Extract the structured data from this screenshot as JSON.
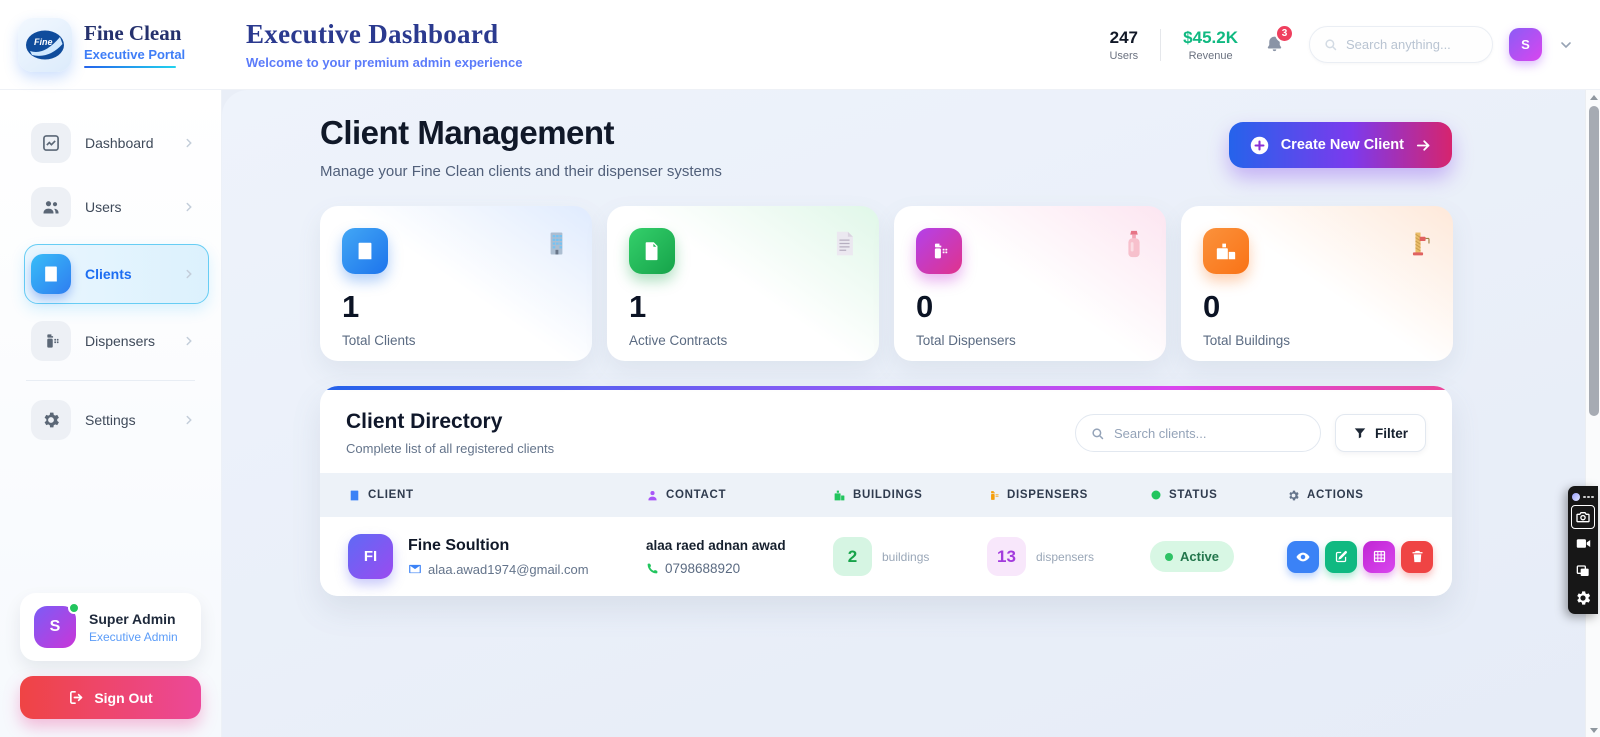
{
  "colors": {
    "accent_blue": "#2563eb",
    "accent_purple": "#8b5cf6",
    "accent_pink": "#ec4899",
    "revenue_green": "#10b981",
    "danger_red": "#ef4444",
    "active_green": "#22c55e"
  },
  "header": {
    "brand_title": "Fine Clean",
    "brand_subtitle": "Executive Portal",
    "title": "Executive Dashboard",
    "subtitle": "Welcome to your premium admin experience",
    "stats": [
      {
        "value": "247",
        "label": "Users"
      },
      {
        "value": "$45.2K",
        "label": "Revenue"
      }
    ],
    "notification_count": "3",
    "search_placeholder": "Search anything...",
    "avatar_initial": "S"
  },
  "sidebar": {
    "items": [
      {
        "label": "Dashboard",
        "icon": "chart-line-icon"
      },
      {
        "label": "Users",
        "icon": "users-icon"
      },
      {
        "label": "Clients",
        "icon": "building-icon",
        "active": true
      },
      {
        "label": "Dispensers",
        "icon": "dispenser-icon"
      },
      {
        "label": "Settings",
        "icon": "gear-icon"
      }
    ],
    "user": {
      "initial": "S",
      "name": "Super Admin",
      "role": "Executive Admin"
    },
    "signout_label": "Sign Out"
  },
  "main": {
    "page_title": "Client Management",
    "page_subtitle": "Manage your Fine Clean clients and their dispenser systems",
    "create_button_label": "Create New Client",
    "stat_cards": [
      {
        "value": "1",
        "label": "Total Clients",
        "icon": "building-icon",
        "decor_icon": "office-building-emoji"
      },
      {
        "value": "1",
        "label": "Active Contracts",
        "icon": "contract-icon",
        "decor_icon": "document-emoji"
      },
      {
        "value": "0",
        "label": "Total Dispensers",
        "icon": "dispenser-icon",
        "decor_icon": "lotion-bottle-emoji"
      },
      {
        "value": "0",
        "label": "Total Buildings",
        "icon": "city-icon",
        "decor_icon": "crane-emoji"
      }
    ],
    "directory": {
      "title": "Client Directory",
      "subtitle": "Complete list of all registered clients",
      "search_placeholder": "Search clients...",
      "filter_label": "Filter",
      "columns": [
        {
          "label": "CLIENT",
          "icon": "building-icon"
        },
        {
          "label": "CONTACT",
          "icon": "person-icon"
        },
        {
          "label": "BUILDINGS",
          "icon": "buildings-icon"
        },
        {
          "label": "DISPENSERS",
          "icon": "dispenser-icon"
        },
        {
          "label": "STATUS",
          "icon": "status-dot-icon"
        },
        {
          "label": "ACTIONS",
          "icon": "gear-icon"
        }
      ],
      "rows": [
        {
          "initials": "FI",
          "name": "Fine Soultion",
          "email": "alaa.awad1974@gmail.com",
          "contact_name": "alaa raed adnan awad",
          "phone": "0798688920",
          "buildings_count": "2",
          "buildings_unit": "buildings",
          "dispensers_count": "13",
          "dispensers_unit": "dispensers",
          "status": "Active"
        }
      ]
    }
  }
}
